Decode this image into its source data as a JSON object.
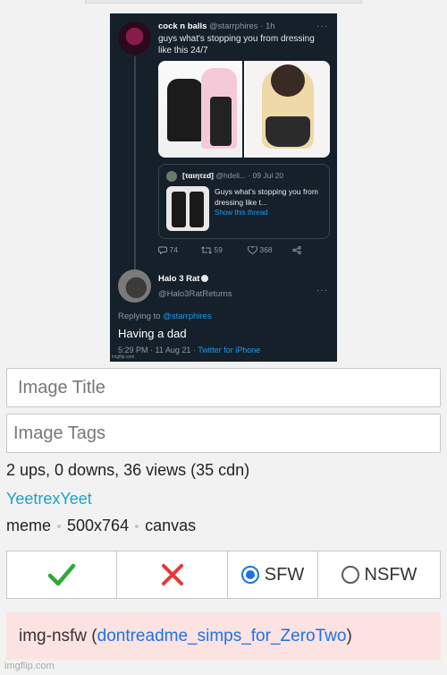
{
  "tweet": {
    "author_name": "cock n balls",
    "author_handle": "@starrphires",
    "time": "· 1h",
    "text": "guys what's stopping you from dressing like this 24/7",
    "quote": {
      "name": "[ταιητεd]",
      "handle": "@hdeli...",
      "date": "· 09 Jul 20",
      "text": "Guys what's stopping you from dressing like t...",
      "link": "Show this thread"
    },
    "counts": {
      "replies": "74",
      "retweets": "59",
      "likes": "368"
    },
    "reply": {
      "name": "Halo 3 Rat",
      "handle": "@Halo3RatReturns",
      "replying_prefix": "Replying to ",
      "replying_to": "@starrphires",
      "text": "Having a dad",
      "meta": "5:29 PM · 11 Aug 21 · ",
      "client": "Twitter for iPhone"
    },
    "image_watermark": "imgflip.com",
    "more": "···"
  },
  "form": {
    "title_placeholder": "Image Title",
    "tags_placeholder": "Image Tags"
  },
  "stats": "2 ups, 0 downs, 36 views (35 cdn)",
  "username": "YeetrexYeet",
  "meta": {
    "type": "meme",
    "size": "500x764",
    "render": "canvas"
  },
  "buttons": {
    "approve_icon": "check-icon",
    "reject_icon": "x-icon",
    "sfw_label": "SFW",
    "nsfw_label": "NSFW",
    "sfw_selected": true
  },
  "nsfw_notice": {
    "prefix": "img-nsfw (",
    "link": "dontreadme_simps_for_ZeroTwo",
    "suffix": ")"
  },
  "footer_watermark": "imgflip.com",
  "colors": {
    "approve": "#2eaa3a",
    "reject": "#e53935",
    "link": "#1ba3c7",
    "radio": "#1a73e8",
    "notice_bg": "#fde2e2"
  }
}
